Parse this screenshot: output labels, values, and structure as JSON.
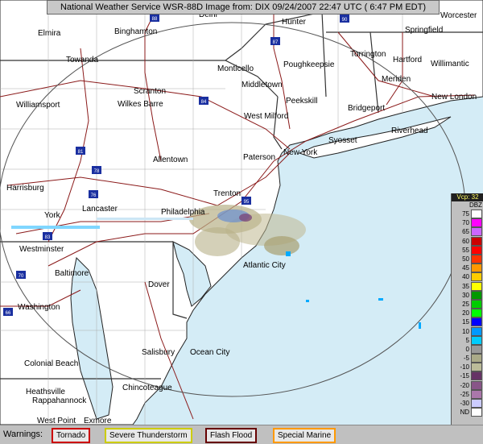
{
  "header": {
    "title": "National Weather Service WSR-88D Image from: DIX 09/24/2007 22:47 UTC ( 6:47 PM EDT)"
  },
  "map": {
    "cities": [
      "Delhi",
      "Hunter",
      "Worcester",
      "Elmira",
      "Binghamton",
      "Springfield",
      "Torrington",
      "Hartford",
      "Willimantic",
      "Towanda",
      "Monticello",
      "Poughkeepsie",
      "Meriden",
      "Middletown",
      "New London",
      "Scranton",
      "Wilkes Barre",
      "Peekskill",
      "Williamsport",
      "West Milford",
      "Bridgeport",
      "Riverhead",
      "Syosset",
      "New York",
      "Paterson",
      "Allentown",
      "Harrisburg",
      "Trenton",
      "Lancaster",
      "York",
      "Philadelphia",
      "Westminster",
      "Baltimore",
      "Atlantic City",
      "Dover",
      "Washington",
      "Salisbury",
      "Ocean City",
      "Colonial Beach",
      "Chincoteague",
      "Heathsville",
      "Rappahannock",
      "West Point",
      "Exmore"
    ],
    "interstates": [
      "88",
      "90",
      "87",
      "84",
      "81",
      "78",
      "76",
      "95",
      "83",
      "70",
      "66"
    ],
    "colors": {
      "ocean": "#d4ecf6",
      "land": "#ffffff",
      "roads": "#8b1a1a",
      "borders": "#333333",
      "range_ring": "#555555"
    }
  },
  "legend": {
    "mode": "Vcp: 32",
    "unit": "DBZ",
    "levels": [
      {
        "label": "75",
        "color": "#ffffff"
      },
      {
        "label": "70",
        "color": "#ff00ff"
      },
      {
        "label": "65",
        "color": "#cc66ff"
      },
      {
        "label": "60",
        "color": "#cc0000"
      },
      {
        "label": "55",
        "color": "#ff0000"
      },
      {
        "label": "50",
        "color": "#ff3300"
      },
      {
        "label": "45",
        "color": "#ff9900"
      },
      {
        "label": "40",
        "color": "#ffcc00"
      },
      {
        "label": "35",
        "color": "#ffff00"
      },
      {
        "label": "30",
        "color": "#009900"
      },
      {
        "label": "25",
        "color": "#00cc00"
      },
      {
        "label": "20",
        "color": "#00ff00"
      },
      {
        "label": "15",
        "color": "#0000ff"
      },
      {
        "label": "10",
        "color": "#0099ff"
      },
      {
        "label": "5",
        "color": "#00ccff"
      },
      {
        "label": "0",
        "color": "#999999"
      },
      {
        "label": "-5",
        "color": "#aaaa88"
      },
      {
        "label": "-10",
        "color": "#bbbb99"
      },
      {
        "label": "-15",
        "color": "#663366"
      },
      {
        "label": "-20",
        "color": "#885588"
      },
      {
        "label": "-25",
        "color": "#aa77aa"
      },
      {
        "label": "-30",
        "color": "#ccccff"
      },
      {
        "label": "ND",
        "color": "#ffffff"
      }
    ]
  },
  "warnings": {
    "label": "Warnings:",
    "items": [
      {
        "label": "Tornado",
        "color": "#cc0000"
      },
      {
        "label": "Severe Thunderstorm",
        "color": "#cccc00"
      },
      {
        "label": "Flash Flood",
        "color": "#660000"
      },
      {
        "label": "Special Marine",
        "color": "#ff9900"
      }
    ]
  }
}
